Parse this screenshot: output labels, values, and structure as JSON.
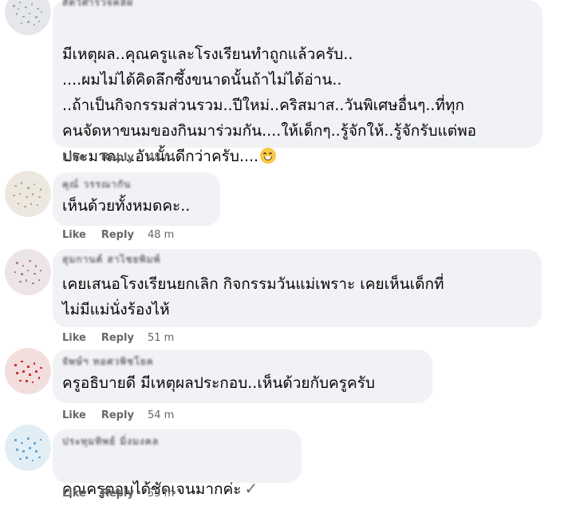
{
  "comments": [
    {
      "author": "สัตว์ตำรวจคลิฝ",
      "text": "มีเหตุผล..คุณครูและโรงเรียนทำถูกแล้วครับ..\n....ผมไม่ได้คิดลึกซึ้งขนาดนั้นถ้าไม่ได้อ่าน..\n..ถ้าเป็นกิจกรรมส่วนรวม..ปีใหม่..คริสมาส..วันพิเศษอื่นๆ..ที่ทุก\nคนจัดหาขนมของกินมาร่วมกัน....ให้เด็กๆ..รู้จักให้..รู้จักรับแต่พอ\nประมาณ...อันนั้นดีกว่าครับ....",
      "emoji": "grinning-face-emoji",
      "like_label": "Like",
      "reply_label": "Reply",
      "time": "48 m",
      "avatar_color": "#9aa0a8"
    },
    {
      "author": "คุณ์ วรรณากัน",
      "text": "เห็นด้วยทั้งหมดคะ..",
      "like_label": "Like",
      "reply_label": "Reply",
      "time": "48 m",
      "avatar_color": "#b0a48a"
    },
    {
      "author": "สุมกานต์ สาไชยพิมพ์",
      "text": "เคยเสนอโรงเรียนยกเลิก กิจกรรมวันแม่เพราะ เคยเห็นเด็กที่\nไม่มีแม่นั่งร้องไห้",
      "like_label": "Like",
      "reply_label": "Reply",
      "time": "51 m",
      "avatar_color": "#a07080"
    },
    {
      "author": "จัพษ์ฯ ทอศวพิชโยค",
      "text": "ครูอธิบายดี มีเหตุผลประกอบ..เห็นด้วยกับครูครับ",
      "like_label": "Like",
      "reply_label": "Reply",
      "time": "54 m",
      "avatar_color": "#d02020"
    },
    {
      "author": "ประทุมทิพย์ มิ่งมงคล",
      "text": "คุณครูตอบได้ชัดเจนมากค่ะ",
      "suffix_icon": "checkmark-icon",
      "like_label": "Like",
      "reply_label": "Reply",
      "time": "55 m",
      "avatar_color": "#5aa0d0"
    }
  ]
}
